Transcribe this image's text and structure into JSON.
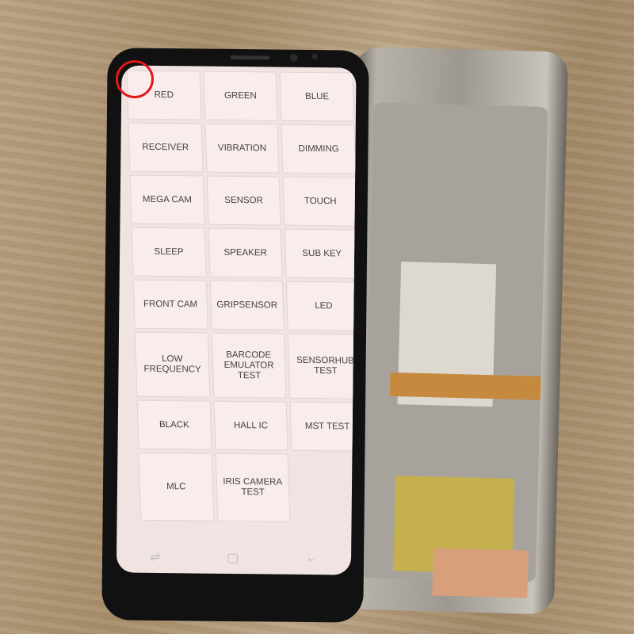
{
  "menu": {
    "items": [
      "RED",
      "GREEN",
      "BLUE",
      "RECEIVER",
      "VIBRATION",
      "DIMMING",
      "MEGA CAM",
      "SENSOR",
      "TOUCH",
      "SLEEP",
      "SPEAKER",
      "SUB KEY",
      "FRONT CAM",
      "GRIPSENSOR",
      "LED",
      "LOW FREQUENCY",
      "BARCODE EMULATOR TEST",
      "SENSORHUB TEST",
      "BLACK",
      "HALL IC",
      "MST TEST",
      "MLC",
      "IRIS CAMERA TEST"
    ]
  },
  "navbar": {
    "icons": [
      "recent-apps-icon",
      "home-icon",
      "back-icon"
    ],
    "glyphs": [
      "⇌",
      "▢",
      "←"
    ]
  },
  "highlight_color": "#e01818"
}
